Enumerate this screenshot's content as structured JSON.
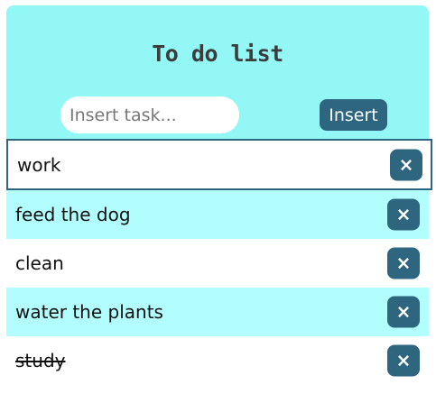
{
  "header": {
    "title": "To do list"
  },
  "input": {
    "placeholder": "Insert task...",
    "value": ""
  },
  "insert_button": {
    "label": "Insert"
  },
  "delete_icon": "close-icon",
  "delete_label": "×",
  "colors": {
    "panel": "#93f7f6",
    "accent": "#2e6680",
    "alt_row": "#b2fefe"
  },
  "tasks": [
    {
      "label": "work",
      "selected": true,
      "done": false
    },
    {
      "label": "feed the dog",
      "selected": false,
      "done": false
    },
    {
      "label": "clean",
      "selected": false,
      "done": false
    },
    {
      "label": "water the plants",
      "selected": false,
      "done": false
    },
    {
      "label": "study",
      "selected": false,
      "done": true
    }
  ]
}
